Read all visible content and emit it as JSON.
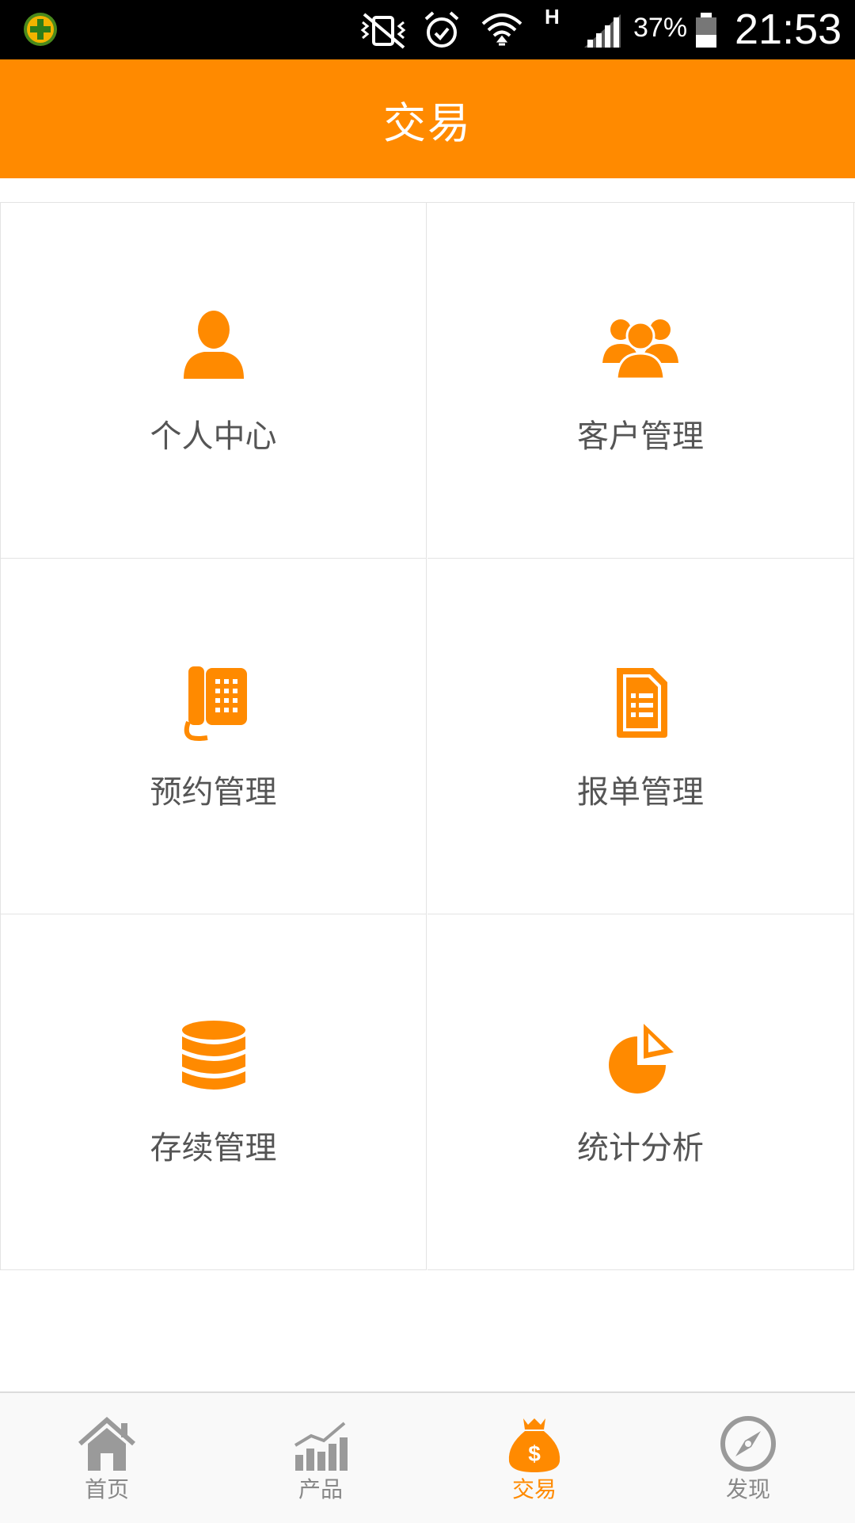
{
  "status_bar": {
    "battery": "37%",
    "time": "21:53",
    "network_type": "H",
    "icons": [
      "app-notification-icon",
      "vibrate-mute-icon",
      "alarm-icon",
      "wifi-icon",
      "signal-icon",
      "battery-icon"
    ]
  },
  "header": {
    "title": "交易"
  },
  "colors": {
    "accent": "#ff8a00",
    "text": "#555555",
    "nav_inactive": "#888888"
  },
  "grid": {
    "items": [
      {
        "label": "个人中心",
        "icon": "person-icon"
      },
      {
        "label": "客户管理",
        "icon": "group-icon"
      },
      {
        "label": "预约管理",
        "icon": "telephone-icon"
      },
      {
        "label": "报单管理",
        "icon": "document-icon"
      },
      {
        "label": "存续管理",
        "icon": "database-icon"
      },
      {
        "label": "统计分析",
        "icon": "pie-chart-icon"
      }
    ]
  },
  "bottom_nav": {
    "items": [
      {
        "label": "首页",
        "icon": "home-icon",
        "active": false
      },
      {
        "label": "产品",
        "icon": "bar-chart-icon",
        "active": false
      },
      {
        "label": "交易",
        "icon": "money-bag-icon",
        "active": true
      },
      {
        "label": "发现",
        "icon": "compass-icon",
        "active": false
      }
    ]
  }
}
